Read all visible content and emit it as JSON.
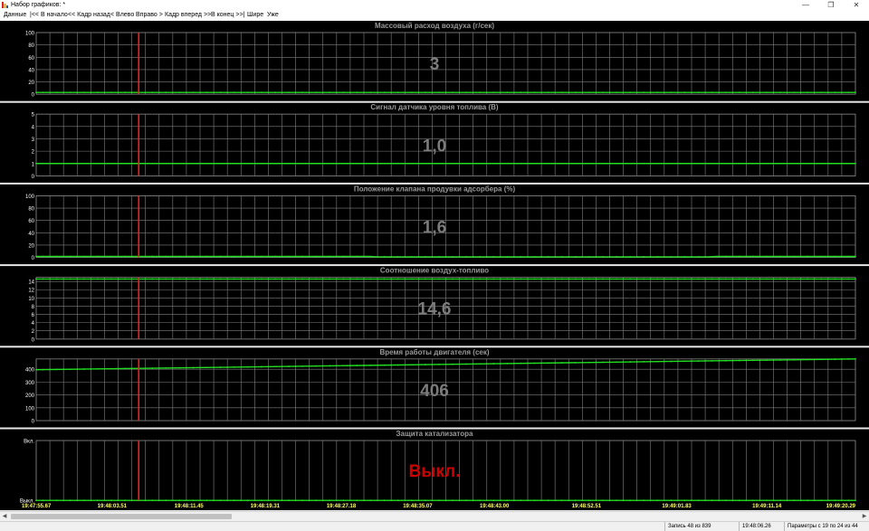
{
  "window": {
    "title": "Набор графиков: *",
    "controls": {
      "minimize": "—",
      "maximize": "❐",
      "close": "✕"
    }
  },
  "menu": {
    "items": [
      {
        "id": "data",
        "label": "Данные"
      },
      {
        "id": "to-start",
        "label": "|<< В начало"
      },
      {
        "id": "frame-back",
        "label": "<< Кадр назад"
      },
      {
        "id": "left",
        "label": "< Влево"
      },
      {
        "id": "right",
        "label": "Вправо >"
      },
      {
        "id": "frame-forward",
        "label": "Кадр вперед >>"
      },
      {
        "id": "to-end",
        "label": "В конец >>|"
      },
      {
        "id": "wider",
        "label": "Шире"
      },
      {
        "id": "narrower",
        "label": "Уже"
      }
    ]
  },
  "colors": {
    "chart_bg": "#000000",
    "grid": "#808080",
    "series": "#22dd22",
    "marker": "#ff1a1a",
    "title": "#9a9a9a",
    "value": "#7c7c7c",
    "value_off": "#cc0000",
    "time_labels": "#ffff66",
    "tick_labels": "#ffffff"
  },
  "cursor_time": "19:48:06.26",
  "chart_data": [
    {
      "type": "line",
      "title": "Массовый расход воздуха  (г/сек)",
      "current_value": "3",
      "ylim": [
        0,
        100
      ],
      "yticks": [
        "100",
        "80",
        "60",
        "40",
        "20",
        "0"
      ],
      "xlim": [
        "19:47:55.67",
        "19:49:20.29"
      ],
      "series": [
        {
          "x": [
            "19:47:55.67",
            "19:49:20.29"
          ],
          "y": [
            3,
            3
          ]
        }
      ]
    },
    {
      "type": "line",
      "title": "Сигнал датчика уровня топлива  (В)",
      "current_value": "1,0",
      "ylim": [
        0,
        5
      ],
      "yticks": [
        "5",
        "4",
        "3",
        "2",
        "1",
        "0"
      ],
      "xlim": [
        "19:47:55.67",
        "19:49:20.29"
      ],
      "series": [
        {
          "x": [
            "19:47:55.67",
            "19:49:20.29"
          ],
          "y": [
            1.0,
            1.0
          ]
        }
      ]
    },
    {
      "type": "line",
      "title": "Положение клапана продувки адсорбера  (%)",
      "current_value": "1,6",
      "ylim": [
        0,
        100
      ],
      "yticks": [
        "100",
        "80",
        "60",
        "40",
        "20",
        "0"
      ],
      "xlim": [
        "19:47:55.67",
        "19:49:20.29"
      ],
      "series": [
        {
          "x": [
            "19:47:55.67",
            "19:48:00.00",
            "19:48:30.00",
            "19:48:31.00",
            "19:49:05.00",
            "19:49:06.00",
            "19:49:20.29"
          ],
          "y": [
            1.6,
            1.6,
            1.6,
            1.0,
            1.0,
            1.6,
            1.6
          ]
        }
      ]
    },
    {
      "type": "line",
      "title": "Соотношение воздух-топливо",
      "current_value": "14,6",
      "ylim": [
        0,
        15
      ],
      "yticks": [
        "14",
        "12",
        "10",
        "8",
        "6",
        "4",
        "2",
        "0"
      ],
      "xlim": [
        "19:47:55.67",
        "19:49:20.29"
      ],
      "series": [
        {
          "x": [
            "19:47:55.67",
            "19:49:20.29"
          ],
          "y": [
            14.6,
            14.6
          ]
        }
      ]
    },
    {
      "type": "line",
      "title": "Время работы двигателя  (сек)",
      "current_value": "406",
      "ylim": [
        0,
        480
      ],
      "yticks": [
        "400",
        "300",
        "200",
        "100",
        "0"
      ],
      "xlim": [
        "19:47:55.67",
        "19:49:20.29"
      ],
      "series": [
        {
          "x": [
            "19:47:55.67",
            "19:49:20.29"
          ],
          "y": [
            396,
            480
          ]
        }
      ]
    },
    {
      "type": "line",
      "title": "Защита катализатора",
      "current_value": "Выкл.",
      "ylim": [
        0,
        1
      ],
      "yticks": [
        "Вкл.",
        "Выкл."
      ],
      "xlim": [
        "19:47:55.67",
        "19:49:20.29"
      ],
      "series": [
        {
          "x": [
            "19:47:55.67",
            "19:49:20.29"
          ],
          "y": [
            0,
            0
          ]
        }
      ]
    }
  ],
  "time_axis": {
    "labels": [
      "19:47:55.67",
      "19:48:03.51",
      "19:48:11.45",
      "19:48:19.31",
      "19:48:27.18",
      "19:48:35.07",
      "19:48:43.00",
      "19:48:52.51",
      "19:49:01.83",
      "19:49:11.14",
      "19:49:20.29"
    ]
  },
  "status": {
    "record": "Запись 48 из 839",
    "time": "19:48:06.26",
    "params": "Параметры с 19 по 24 из 44"
  }
}
